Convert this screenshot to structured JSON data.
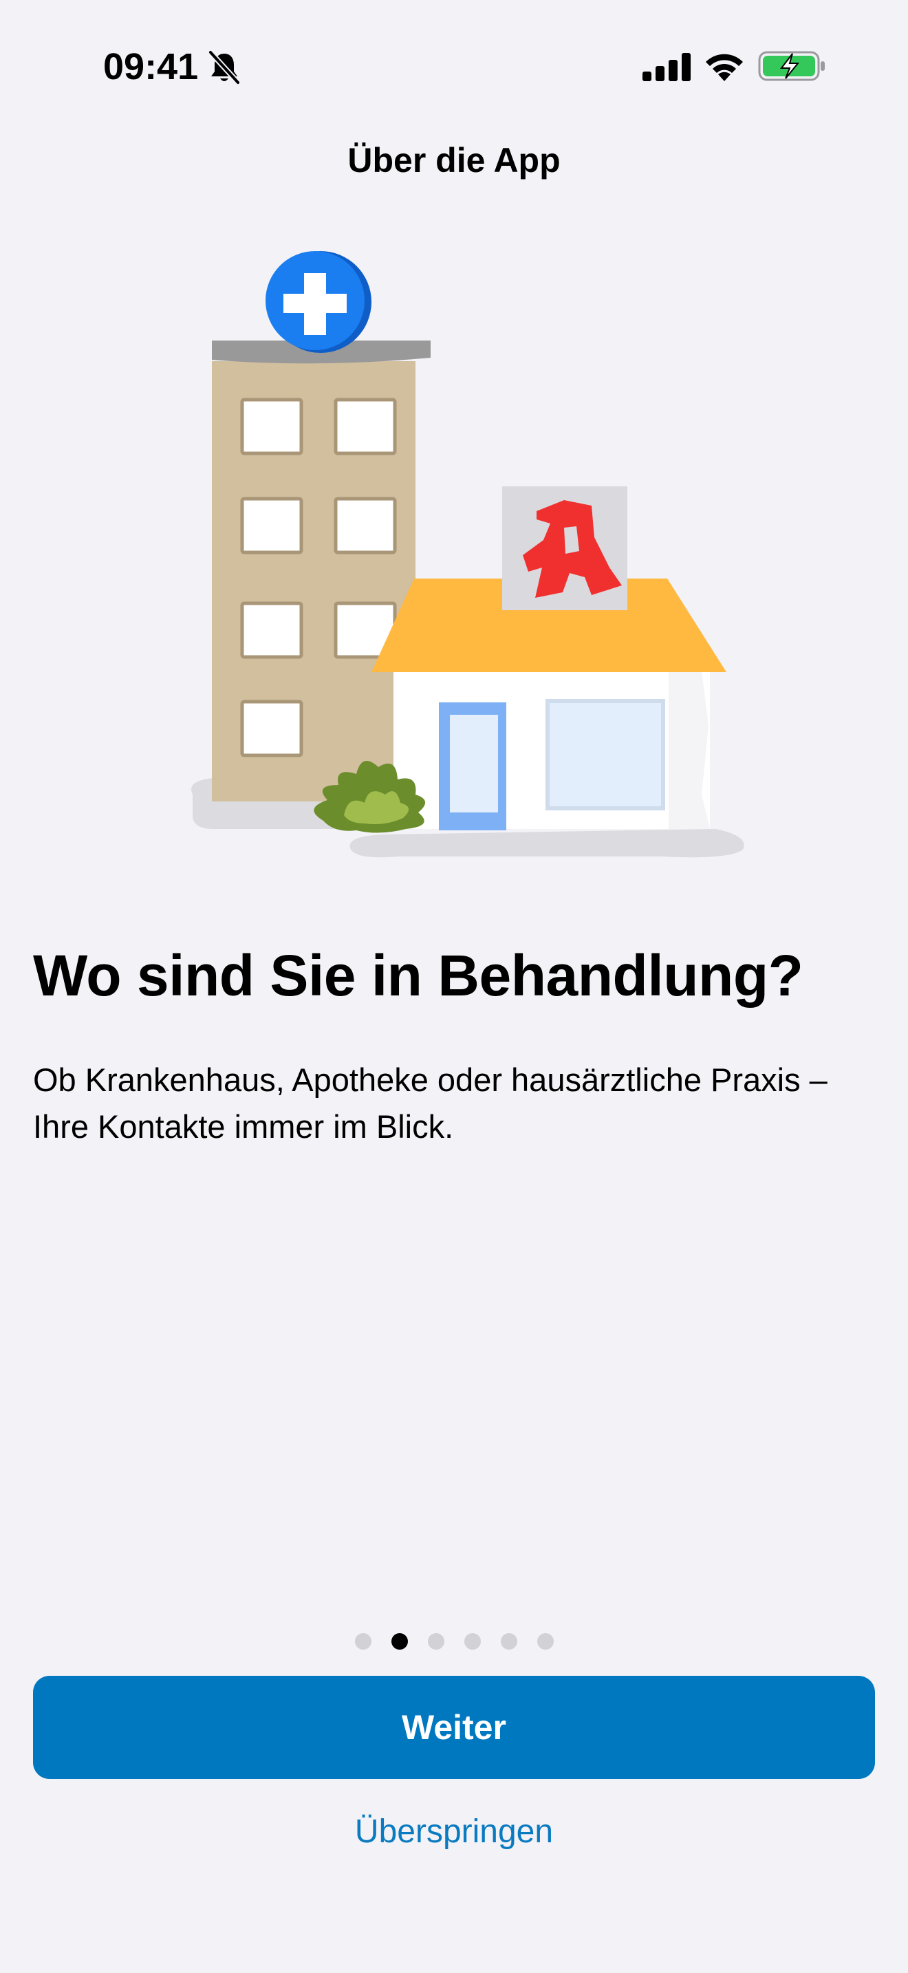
{
  "status_bar": {
    "time": "09:41",
    "icons": [
      "bell-slash-icon",
      "cellular-signal-icon",
      "wifi-icon",
      "battery-charging-icon"
    ]
  },
  "nav": {
    "title": "Über die App"
  },
  "illustration": {
    "icon": "hospital-and-pharmacy-illustration",
    "pharmacy_sign": "A"
  },
  "content": {
    "headline": "Wo sind Sie in Behandlung?",
    "body": "Ob Krankenhaus, Apotheke oder hausärztliche Praxis – Ihre Kontakte immer im Blick."
  },
  "pager": {
    "count": 6,
    "active_index": 1
  },
  "actions": {
    "primary_label": "Weiter",
    "skip_label": "Überspringen"
  },
  "colors": {
    "background": "#f2f2f7",
    "primary": "#0078c0",
    "link": "#0a7bc0",
    "cross_blue": "#1a7ef0",
    "pharmacy_red": "#f0302e",
    "roof_yellow": "#ffb840",
    "battery_green": "#34c759"
  }
}
